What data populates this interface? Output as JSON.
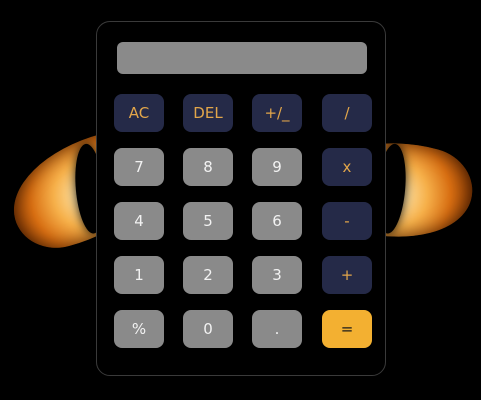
{
  "display": {
    "value": ""
  },
  "keys": {
    "ac": "AC",
    "del": "DEL",
    "sign": "+/_",
    "divide": "/",
    "seven": "7",
    "eight": "8",
    "nine": "9",
    "multiply": "x",
    "four": "4",
    "five": "5",
    "six": "6",
    "minus": "-",
    "one": "1",
    "two": "2",
    "three": "3",
    "plus": "+",
    "percent": "%",
    "zero": "0",
    "dot": ".",
    "equals": "="
  },
  "colors": {
    "background": "#000000",
    "display": "#8a8a8a",
    "function_key": "#252a48",
    "function_text": "#e2a64a",
    "number_key": "#8a8a8a",
    "number_text": "#f2f2f2",
    "equals_key": "#f3b031"
  },
  "decorations": {
    "background_image": "cat-eyes"
  }
}
